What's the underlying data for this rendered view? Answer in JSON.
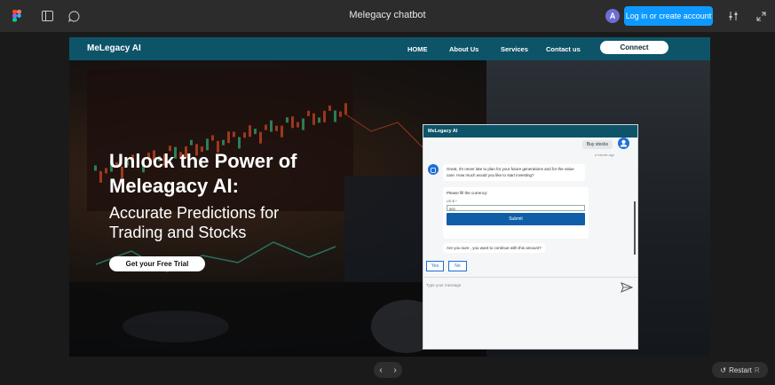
{
  "app": {
    "title": "Melegacy chatbot",
    "avatar_initial": "A",
    "login_label": "Log in or create account"
  },
  "icons": [
    "figma-logo-icon",
    "sidebar-toggle-icon",
    "comment-icon",
    "settings-sliders-icon",
    "expand-icon",
    "send-icon",
    "restart-icon"
  ],
  "site": {
    "brand": "MeLegacy AI",
    "nav": [
      "HOME",
      "About Us",
      "Services",
      "Contact us"
    ],
    "connect_label": "Connect",
    "headline_1": "Unlock the Power of",
    "headline_2": "Meleagacy AI:",
    "sub_1": "Accurate Predictions for",
    "sub_2": "Trading and Stocks",
    "cta_label": "Get your Free Trial"
  },
  "chat": {
    "header": "MeLegacy AI",
    "user_msg": "Buy stocks",
    "user_time": "a minute ago",
    "bot_msg": "Great, it's never late to plan for your future generations and for the value care. How much would you like to start investing?",
    "form_label": "Please fill the currency:",
    "currency_label": "US $ *",
    "amount_value": "500",
    "submit_label": "Submit",
    "confirm_msg": "Are you sure , you want to continue with this amount?",
    "yes_label": "Yes",
    "no_label": "No",
    "input_placeholder": "Type your message"
  },
  "controls": {
    "prev": "‹",
    "next": "›",
    "restart_label": "Restart",
    "restart_key": "R"
  }
}
